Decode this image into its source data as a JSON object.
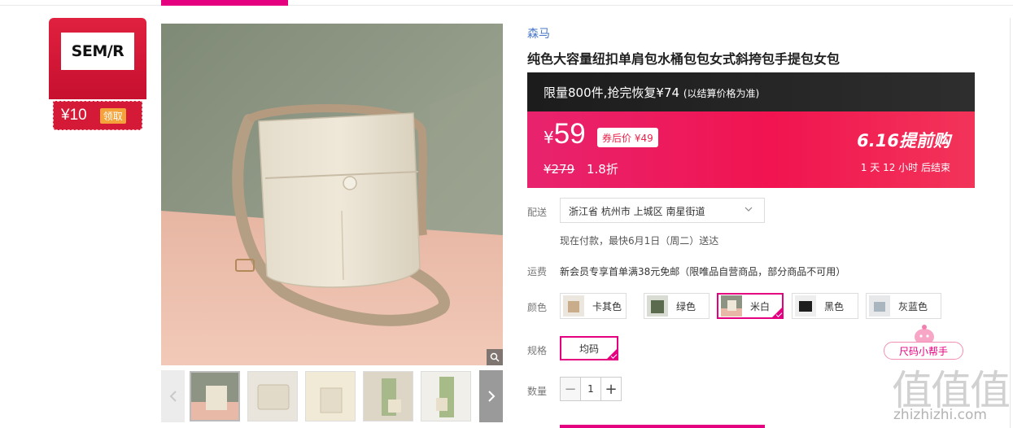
{
  "coupon": {
    "brand_logo_text": "SEM/R",
    "amount": "¥10",
    "claim_label": "领取"
  },
  "product": {
    "brand": "森马",
    "title": "纯色大容量纽扣单肩包水桶包包女式斜挎包手提包女包"
  },
  "promo": {
    "limit_text": "限量800件,抢完恢复¥74",
    "limit_note": "(以结算价格为准)",
    "currency": "¥",
    "price": "59",
    "after_coupon": "券后价 ¥49",
    "original_price": "¥279",
    "discount": "1.8折",
    "event_title": "6.16提前购",
    "countdown": "1 天 12 小时 后结束"
  },
  "delivery": {
    "label": "配送",
    "address": "浙江省 杭州市 上城区 南星街道",
    "note": "现在付款，最快6月1日（周二）送达"
  },
  "shipping": {
    "label": "运费",
    "text": "新会员专享首单满38元免邮（限唯品自营商品，部分商品不可用）"
  },
  "color": {
    "label": "颜色",
    "options": [
      "卡其色",
      "绿色",
      "米白",
      "黑色",
      "灰蓝色"
    ],
    "selected": "米白"
  },
  "spec": {
    "label": "规格",
    "value": "均码"
  },
  "quantity": {
    "label": "数量",
    "value": "1",
    "minus": "−",
    "plus": "+"
  },
  "size_helper": {
    "label": "尺码小帮手"
  },
  "watermark": {
    "logo": "值值值",
    "site": "zhizhizhi.com"
  },
  "colors": {
    "accent": "#e5007f",
    "promo_red": "#f11450",
    "brand_link": "#4a79c8",
    "coupon_red": "#d41a36"
  }
}
